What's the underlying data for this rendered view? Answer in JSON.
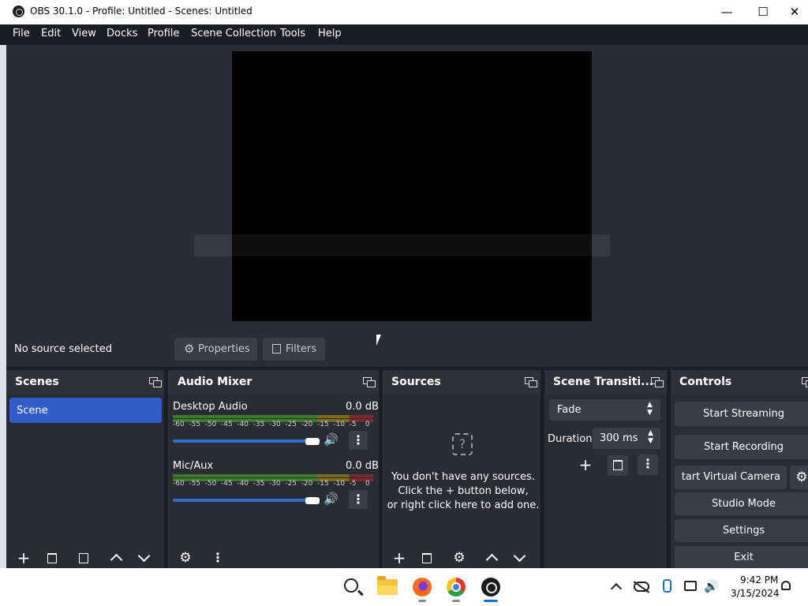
{
  "window": {
    "title": "OBS 30.1.0 - Profile: Untitled - Scenes: Untitled",
    "minimize": "—",
    "maximize": "☐",
    "close": "✕"
  },
  "menu": [
    "File",
    "Edit",
    "View",
    "Docks",
    "Profile",
    "Scene Collection",
    "Tools",
    "Help"
  ],
  "source_bar": {
    "status": "No source selected",
    "properties": "Properties",
    "filters": "Filters"
  },
  "scenes": {
    "title": "Scenes",
    "items": [
      "Scene"
    ]
  },
  "audio_mixer": {
    "title": "Audio Mixer",
    "channels": [
      {
        "name": "Desktop Audio",
        "level": "0.0 dB",
        "volume_fraction": 1.0
      },
      {
        "name": "Mic/Aux",
        "level": "0.0 dB",
        "volume_fraction": 1.0
      }
    ],
    "scale": [
      "-60",
      "-55",
      "-50",
      "-45",
      "-40",
      "-35",
      "-30",
      "-25",
      "-20",
      "-15",
      "-10",
      "-5",
      "0"
    ]
  },
  "sources": {
    "title": "Sources",
    "empty_line1": "You don't have any sources.",
    "empty_line2": "Click the + button below,",
    "empty_line3": "or right click here to add one."
  },
  "transitions": {
    "title": "Scene Transiti...",
    "selected": "Fade",
    "duration_label": "Duration",
    "duration_value": "300 ms"
  },
  "controls": {
    "title": "Controls",
    "start_streaming": "Start Streaming",
    "start_recording": "Start Recording",
    "start_virtual_camera": "tart Virtual Camera",
    "studio_mode": "Studio Mode",
    "settings": "Settings",
    "exit": "Exit"
  },
  "taskbar": {
    "time": "9:42 PM",
    "date": "3/15/2024"
  },
  "colors": {
    "accent": "#2f5cc8",
    "panel": "#2a2b33",
    "background": "#1c1d22"
  }
}
